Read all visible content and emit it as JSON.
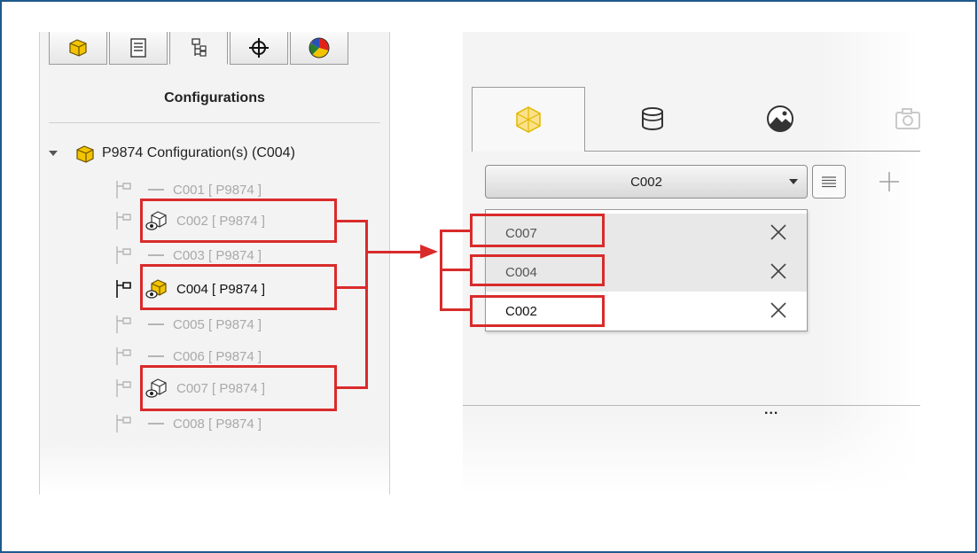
{
  "left_panel": {
    "tabs": [
      {
        "name": "feature-manager",
        "icon": "part-icon"
      },
      {
        "name": "property-manager",
        "icon": "property-list-icon"
      },
      {
        "name": "configuration-manager",
        "icon": "configuration-tree-icon"
      },
      {
        "name": "dimxpert-manager",
        "icon": "crosshair-icon"
      },
      {
        "name": "display-manager",
        "icon": "color-wheel-icon"
      }
    ],
    "title": "Configurations",
    "root": {
      "label": "P9874 Configuration(s)  (C004)"
    },
    "configurations": [
      {
        "label": "C001 [ P9874 ]",
        "state": "inactive",
        "icon": "dash"
      },
      {
        "label": "C002 [ P9874 ]",
        "state": "inactive",
        "icon": "hidden-part-eye-icon",
        "highlighted": true
      },
      {
        "label": "C003 [ P9874 ]",
        "state": "inactive",
        "icon": "dash"
      },
      {
        "label": "C004 [ P9874 ]",
        "state": "active",
        "icon": "part-eye-icon",
        "highlighted": true
      },
      {
        "label": "C005 [ P9874 ]",
        "state": "inactive",
        "icon": "dash"
      },
      {
        "label": "C006 [ P9874 ]",
        "state": "inactive",
        "icon": "dash"
      },
      {
        "label": "C007 [ P9874 ]",
        "state": "inactive",
        "icon": "hidden-part-eye-icon",
        "highlighted": true
      },
      {
        "label": "C008 [ P9874 ]",
        "state": "inactive",
        "icon": "dash"
      }
    ]
  },
  "right_panel": {
    "tabs": [
      {
        "icon": "model-cube-icon",
        "active": true
      },
      {
        "icon": "appearance-can-icon",
        "active": false
      },
      {
        "icon": "scene-icon",
        "active": false
      },
      {
        "icon": "camera-icon",
        "active": false
      }
    ],
    "combo": {
      "selected": "C002"
    },
    "dropdown_items": [
      {
        "label": "C007",
        "highlighted": true
      },
      {
        "label": "C004",
        "highlighted": true
      },
      {
        "label": "C002",
        "highlighted": true
      }
    ],
    "more_indicator": "..."
  },
  "colors": {
    "highlight": "#d92b2b",
    "frame": "#1e5a8c",
    "accent_yellow": "#f2c400"
  }
}
